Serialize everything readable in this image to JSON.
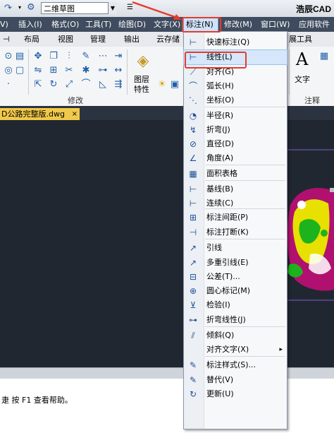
{
  "quick_access": {
    "workspace_value": "二维草图",
    "app_title": "浩辰CAD"
  },
  "menubar": {
    "items": [
      {
        "label": "V)"
      },
      {
        "label": "插入(I)"
      },
      {
        "label": "格式(O)"
      },
      {
        "label": "工具(T)"
      },
      {
        "label": "绘图(D)"
      },
      {
        "label": "文字(X)"
      },
      {
        "label": "标注(N)"
      },
      {
        "label": "修改(M)"
      },
      {
        "label": "窗口(W)"
      },
      {
        "label": "应用软件"
      }
    ]
  },
  "ribbon_tabs": [
    {
      "label": "布局"
    },
    {
      "label": "视图"
    },
    {
      "label": "管理"
    },
    {
      "label": "输出"
    },
    {
      "label": "云存储"
    },
    {
      "label": "展工具"
    }
  ],
  "ribbon": {
    "group_modify": "修改",
    "group_annotate": "注释",
    "layer_label_1": "图层",
    "layer_label_2": "特性",
    "text_big": "A",
    "text_label": "文字"
  },
  "document": {
    "tab_title": "D公路完整版.dwg",
    "close_glyph": "×"
  },
  "command_line": {
    "text": "按 F1 查看帮助。",
    "prefix": "疌"
  },
  "dropdown": {
    "items": [
      {
        "icon": "quick-dimension-icon",
        "glyph": "⊢",
        "label": "快速标注(Q)"
      },
      {
        "icon": "linear-dimension-icon",
        "glyph": "⊢",
        "label": "线性(L)"
      },
      {
        "icon": "aligned-dimension-icon",
        "glyph": "⟋",
        "label": "对齐(G)"
      },
      {
        "icon": "arc-length-icon",
        "glyph": "⌒",
        "label": "弧长(H)"
      },
      {
        "icon": "ordinate-icon",
        "glyph": "⋱",
        "label": "坐标(O)"
      },
      {
        "icon": "radius-icon",
        "glyph": "◔",
        "label": "半径(R)"
      },
      {
        "icon": "jogged-icon",
        "glyph": "↯",
        "label": "折弯(J)"
      },
      {
        "icon": "diameter-icon",
        "glyph": "⊘",
        "label": "直径(D)"
      },
      {
        "icon": "angle-icon",
        "glyph": "∠",
        "label": "角度(A)"
      },
      {
        "icon": "area-table-icon",
        "glyph": "▦",
        "label": "面积表格"
      },
      {
        "icon": "baseline-icon",
        "glyph": "⊢",
        "label": "基线(B)"
      },
      {
        "icon": "continue-icon",
        "glyph": "⊢",
        "label": "连续(C)"
      },
      {
        "icon": "dim-space-icon",
        "glyph": "⊞",
        "label": "标注间距(P)"
      },
      {
        "icon": "dim-break-icon",
        "glyph": "⊣",
        "label": "标注打断(K)"
      },
      {
        "icon": "leader-icon",
        "glyph": "↗",
        "label": "引线"
      },
      {
        "icon": "multileader-icon",
        "glyph": "↗",
        "label": "多重引线(E)"
      },
      {
        "icon": "tolerance-icon",
        "glyph": "⊟",
        "label": "公差(T)..."
      },
      {
        "icon": "center-mark-icon",
        "glyph": "⊕",
        "label": "圆心标记(M)"
      },
      {
        "icon": "inspect-icon",
        "glyph": "⊻",
        "label": "检验(I)"
      },
      {
        "icon": "jogged-linear-icon",
        "glyph": "⊶",
        "label": "折弯线性(J)"
      },
      {
        "icon": "oblique-icon",
        "glyph": "⫽",
        "label": "倾斜(Q)"
      },
      {
        "icon": "align-text-icon",
        "glyph": "",
        "label": "对齐文字(X)",
        "submenu": "▸"
      },
      {
        "icon": "dim-style-icon",
        "glyph": "✎",
        "label": "标注样式(S)..."
      },
      {
        "icon": "override-icon",
        "glyph": "✎",
        "label": "替代(V)"
      },
      {
        "icon": "update-icon",
        "glyph": "↻",
        "label": "更新(U)"
      }
    ]
  },
  "colors": {
    "menubar_bg": "#3f4b5e",
    "callout_red": "#e53b2e",
    "highlight": "#d6e7fb",
    "doc_tab": "#f1c94a",
    "canvas_bg": "#212730"
  }
}
